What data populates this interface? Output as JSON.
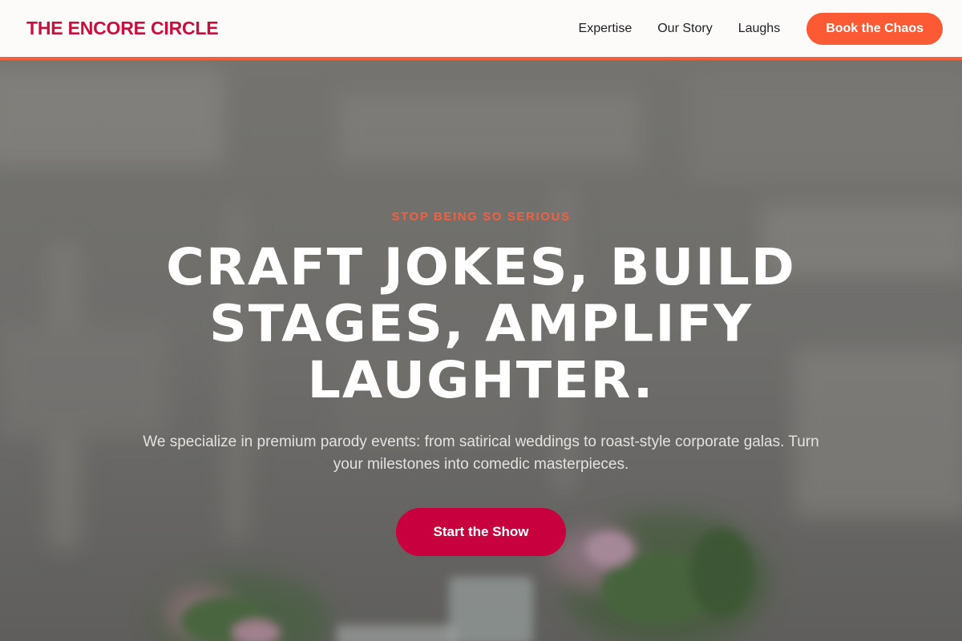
{
  "brand": {
    "name": "THE ENCORE CIRCLE"
  },
  "nav": {
    "links": [
      "Expertise",
      "Our Story",
      "Laughs"
    ],
    "cta_label": "Book the Chaos"
  },
  "hero": {
    "eyebrow": "STOP BEING SO SERIOUS",
    "headline": "CRAFT JOKES, BUILD STAGES, AMPLIFY LAUGHTER.",
    "subtext": "We specialize in premium parody events: from satirical weddings to roast-style corporate galas. Turn your milestones into comedic masterpieces.",
    "button_label": "Start the Show",
    "background": "blurred-event-venue-photo"
  },
  "colors": {
    "brand": "#c8103e",
    "accent": "#f2613f",
    "cta": "#fb5a35",
    "primary_button": "#c8003e",
    "header_bg": "#fcfbfa"
  }
}
